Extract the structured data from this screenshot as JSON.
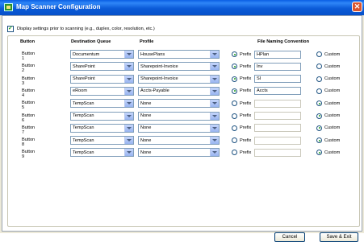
{
  "window": {
    "title": "Map Scanner Configuration"
  },
  "settings": {
    "display_label": "Display settings prior to scanning (e.g., duplex, color, resolution, etc.)",
    "checked": true
  },
  "headers": {
    "button": "Button",
    "queue": "Destination Queue",
    "profile": "Profile",
    "naming": "File Naming Convention"
  },
  "prefix_label": "Prefix",
  "custom_label": "Custom",
  "rows": [
    {
      "button": "Button 1",
      "queue": "Documentum",
      "profile": "HousePlans",
      "mode": "prefix",
      "prefix": "HPlan"
    },
    {
      "button": "Button 2",
      "queue": "SharePoint",
      "profile": "Sharepoint-Invoice",
      "mode": "prefix",
      "prefix": "Inv"
    },
    {
      "button": "Button 3",
      "queue": "SharePoint",
      "profile": "Sharepoint-Invoice",
      "mode": "prefix",
      "prefix": "SI"
    },
    {
      "button": "Button 4",
      "queue": "eRoom",
      "profile": "Accts-Payable",
      "mode": "prefix",
      "prefix": "Accts"
    },
    {
      "button": "Button 5",
      "queue": "TempScan",
      "profile": "None",
      "mode": "custom",
      "prefix": ""
    },
    {
      "button": "Button 6",
      "queue": "TempScan",
      "profile": "None",
      "mode": "custom",
      "prefix": ""
    },
    {
      "button": "Button 7",
      "queue": "TempScan",
      "profile": "None",
      "mode": "custom",
      "prefix": ""
    },
    {
      "button": "Button 8",
      "queue": "TempScan",
      "profile": "None",
      "mode": "custom",
      "prefix": ""
    },
    {
      "button": "Button 9",
      "queue": "TempScan",
      "profile": "None",
      "mode": "custom",
      "prefix": ""
    }
  ],
  "buttons": {
    "cancel": "Cancel",
    "save_exit": "Save & Exit"
  }
}
